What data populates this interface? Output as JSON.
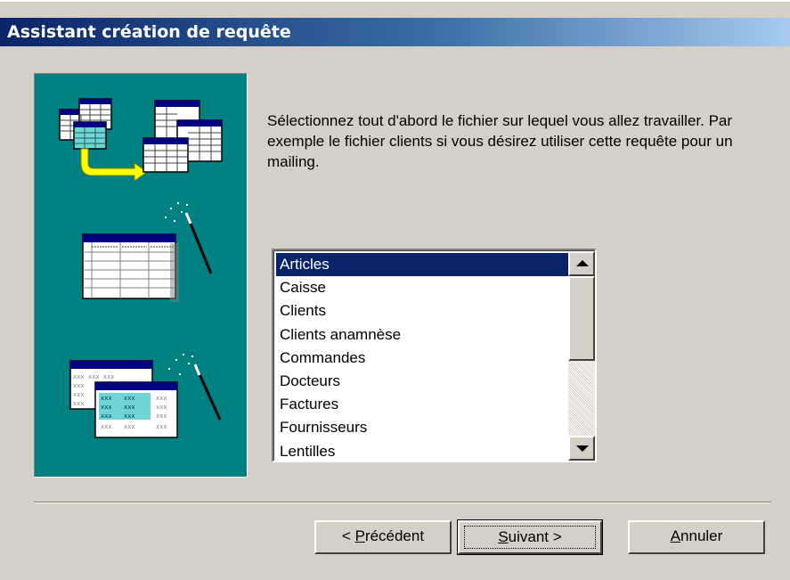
{
  "window": {
    "title": "Assistant création de requête"
  },
  "instructions": "Sélectionnez tout d'abord le fichier sur lequel vous allez travailler. Par exemple le fichier clients si vous désirez utiliser cette requête pour un mailing.",
  "file_list": {
    "items": [
      "Articles",
      "Caisse",
      "Clients",
      "Clients anamnèse",
      "Commandes",
      "Docteurs",
      "Factures",
      "Fournisseurs",
      "Lentilles"
    ],
    "selected": "Articles"
  },
  "buttons": {
    "previous": {
      "prefix": "< ",
      "mnemonic": "P",
      "rest": "récédent"
    },
    "next": {
      "mnemonic": "S",
      "rest": "uivant >"
    },
    "cancel": {
      "mnemonic": "A",
      "rest": "nnuler"
    }
  },
  "illustration": {
    "icons": [
      "tables-join-icon",
      "table-wand-icon",
      "query-grid-wand-icon"
    ],
    "background_color": "#008080",
    "placeholder_text": "xxx"
  },
  "colors": {
    "title_start": "#0a246a",
    "title_end": "#a6caf0",
    "selection": "#0a246a",
    "face": "#d4d0c8"
  }
}
